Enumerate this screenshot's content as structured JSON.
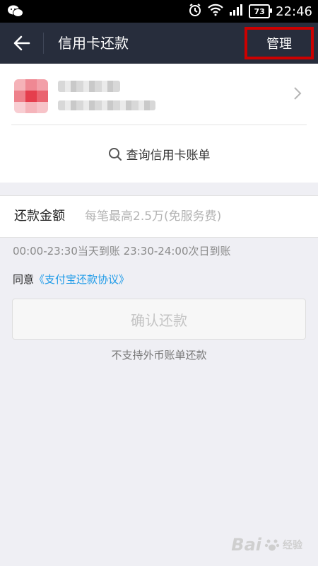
{
  "status_bar": {
    "battery": "73",
    "time": "22:46"
  },
  "nav": {
    "title": "信用卡还款",
    "manage_label": "管理"
  },
  "card": {
    "query_label": "查询信用卡账单"
  },
  "amount": {
    "label": "还款金额",
    "placeholder": "每笔最高2.5万(免服务费)"
  },
  "notes": {
    "arrival_time": "00:00-23:30当天到账  23:30-24:00次日到账",
    "agree_prefix": "同意",
    "agreement_link": "《支付宝还款协议》",
    "foreign_currency": "不支持外币账单还款"
  },
  "confirm_button": {
    "label": "确认还款"
  },
  "watermark": {
    "text": "Bai",
    "sub": "经验"
  },
  "colors": {
    "nav_bg": "#272d3c",
    "highlight_border": "#cc0000",
    "link": "#1f9be8",
    "page_bg": "#efeff4"
  }
}
